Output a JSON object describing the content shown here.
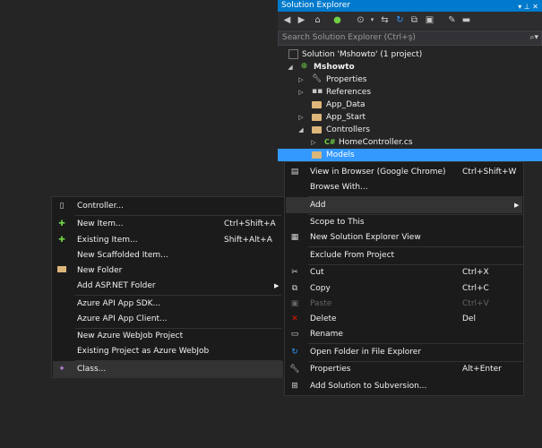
{
  "solution_explorer": {
    "title": "Solution Explorer",
    "search_placeholder": "Search Solution Explorer (Ctrl+ş)",
    "tree": [
      {
        "label": "Solution 'Mshowto' (1 project)",
        "icon": "solution-icon"
      },
      {
        "label": "Mshowto",
        "icon": "web-project-icon"
      },
      {
        "label": "Properties",
        "icon": "wrench-icon"
      },
      {
        "label": "References",
        "icon": "references-icon"
      },
      {
        "label": "App_Data",
        "icon": "folder-icon"
      },
      {
        "label": "App_Start",
        "icon": "folder-icon"
      },
      {
        "label": "Controllers",
        "icon": "folder-icon"
      },
      {
        "label": "HomeController.cs",
        "icon": "csharp-file-icon"
      },
      {
        "label": "Models",
        "icon": "folder-icon"
      }
    ]
  },
  "context_menu": {
    "items": [
      {
        "label": "View in Browser (Google Chrome)",
        "shortcut": "Ctrl+Shift+W",
        "icon": "browser-icon"
      },
      {
        "label": "Browse With...",
        "shortcut": ""
      },
      {
        "label": "Add",
        "shortcut": "",
        "submenu": true
      },
      {
        "label": "Scope to This",
        "shortcut": ""
      },
      {
        "label": "New Solution Explorer View",
        "shortcut": "",
        "icon": "new-view-icon"
      },
      {
        "label": "Exclude From Project",
        "shortcut": ""
      },
      {
        "label": "Cut",
        "shortcut": "Ctrl+X",
        "icon": "cut-icon"
      },
      {
        "label": "Copy",
        "shortcut": "Ctrl+C",
        "icon": "copy-icon"
      },
      {
        "label": "Paste",
        "shortcut": "Ctrl+V",
        "icon": "paste-icon",
        "disabled": true
      },
      {
        "label": "Delete",
        "shortcut": "Del",
        "icon": "delete-icon"
      },
      {
        "label": "Rename",
        "shortcut": "",
        "icon": "rename-icon"
      },
      {
        "label": "Open Folder in File Explorer",
        "shortcut": "",
        "icon": "open-folder-icon"
      },
      {
        "label": "Properties",
        "shortcut": "Alt+Enter",
        "icon": "properties-icon"
      },
      {
        "label": "Add Solution to Subversion...",
        "shortcut": "",
        "icon": "subversion-icon"
      }
    ]
  },
  "add_submenu": {
    "items": [
      {
        "label": "Controller...",
        "shortcut": "",
        "icon": "controller-icon"
      },
      {
        "label": "New Item...",
        "shortcut": "Ctrl+Shift+A",
        "icon": "new-item-icon"
      },
      {
        "label": "Existing Item...",
        "shortcut": "Shift+Alt+A",
        "icon": "existing-item-icon"
      },
      {
        "label": "New Scaffolded Item...",
        "shortcut": ""
      },
      {
        "label": "New Folder",
        "shortcut": "",
        "icon": "new-folder-icon"
      },
      {
        "label": "Add ASP.NET Folder",
        "shortcut": "",
        "submenu": true
      },
      {
        "label": "Azure API App SDK...",
        "shortcut": ""
      },
      {
        "label": "Azure API App Client...",
        "shortcut": ""
      },
      {
        "label": "New Azure WebJob Project",
        "shortcut": ""
      },
      {
        "label": "Existing Project as Azure WebJob",
        "shortcut": ""
      },
      {
        "label": "Class...",
        "shortcut": "",
        "icon": "class-icon"
      }
    ]
  }
}
